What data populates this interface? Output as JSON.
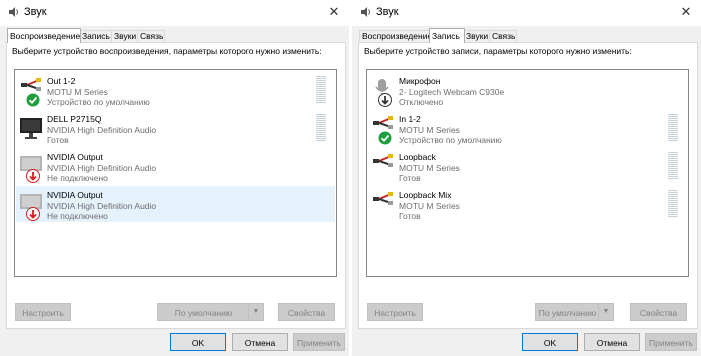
{
  "dialogs": [
    {
      "title": "Звук",
      "close_glyph": "✕",
      "tabs": [
        {
          "label": "Воспроизведение",
          "active": true
        },
        {
          "label": "Запись",
          "active": false
        },
        {
          "label": "Звуки",
          "active": false
        },
        {
          "label": "Связь",
          "active": false
        }
      ],
      "instruction": "Выберите устройство воспроизведения, параметры которого нужно изменить:",
      "devices": [
        {
          "name": "Out 1-2",
          "sub": "MOTU M Series",
          "status": "Устройство по умолчанию",
          "icon": "speaker-cable-icon",
          "badge": "default-check-icon",
          "selected": false,
          "level_meter": true
        },
        {
          "name": "DELL P2715Q",
          "sub": "NVIDIA High Definition Audio",
          "status": "Готов",
          "icon": "monitor-icon",
          "badge": "",
          "selected": false,
          "level_meter": true
        },
        {
          "name": "NVIDIA Output",
          "sub": "NVIDIA High Definition Audio",
          "status": "Не подключено",
          "icon": "monitor-disconnected-icon",
          "badge": "disconnected-arrow-icon",
          "selected": false,
          "level_meter": false
        },
        {
          "name": "NVIDIA Output",
          "sub": "NVIDIA High Definition Audio",
          "status": "Не подключено",
          "icon": "monitor-disconnected-icon",
          "badge": "disconnected-arrow-icon",
          "selected": true,
          "level_meter": false
        }
      ],
      "buttons": {
        "configure": "Настроить",
        "set_default": "По умолчанию",
        "properties": "Свойства",
        "ok": "OK",
        "cancel": "Отмена",
        "apply": "Применить"
      }
    },
    {
      "title": "Звук",
      "close_glyph": "✕",
      "tabs": [
        {
          "label": "Воспроизведение",
          "active": false
        },
        {
          "label": "Запись",
          "active": true
        },
        {
          "label": "Звуки",
          "active": false
        },
        {
          "label": "Связь",
          "active": false
        }
      ],
      "instruction": "Выберите устройство записи, параметры которого нужно изменить:",
      "devices": [
        {
          "name": "Микрофон",
          "sub": "2- Logitech Webcam C930e",
          "status": "Отключено",
          "icon": "microphone-icon",
          "badge": "disabled-arrow-icon",
          "selected": false,
          "level_meter": false
        },
        {
          "name": "In 1-2",
          "sub": "MOTU M Series",
          "status": "Устройство по умолчанию",
          "icon": "line-in-cable-icon",
          "badge": "default-check-icon",
          "selected": false,
          "level_meter": true
        },
        {
          "name": "Loopback",
          "sub": "MOTU M Series",
          "status": "Готов",
          "icon": "line-in-cable-icon",
          "badge": "",
          "selected": false,
          "level_meter": true
        },
        {
          "name": "Loopback Mix",
          "sub": "MOTU M Series",
          "status": "Готов",
          "icon": "line-in-cable-icon",
          "badge": "",
          "selected": false,
          "level_meter": true
        }
      ],
      "buttons": {
        "configure": "Настроить",
        "set_default": "По умолчанию",
        "properties": "Свойства",
        "ok": "OK",
        "cancel": "Отмена",
        "apply": "Применить"
      }
    }
  ],
  "colors": {
    "accent": "#0078d7",
    "selected_row": "#e5f1fb",
    "check_green": "#1e9e3e",
    "disconnected_red": "#d32020"
  }
}
